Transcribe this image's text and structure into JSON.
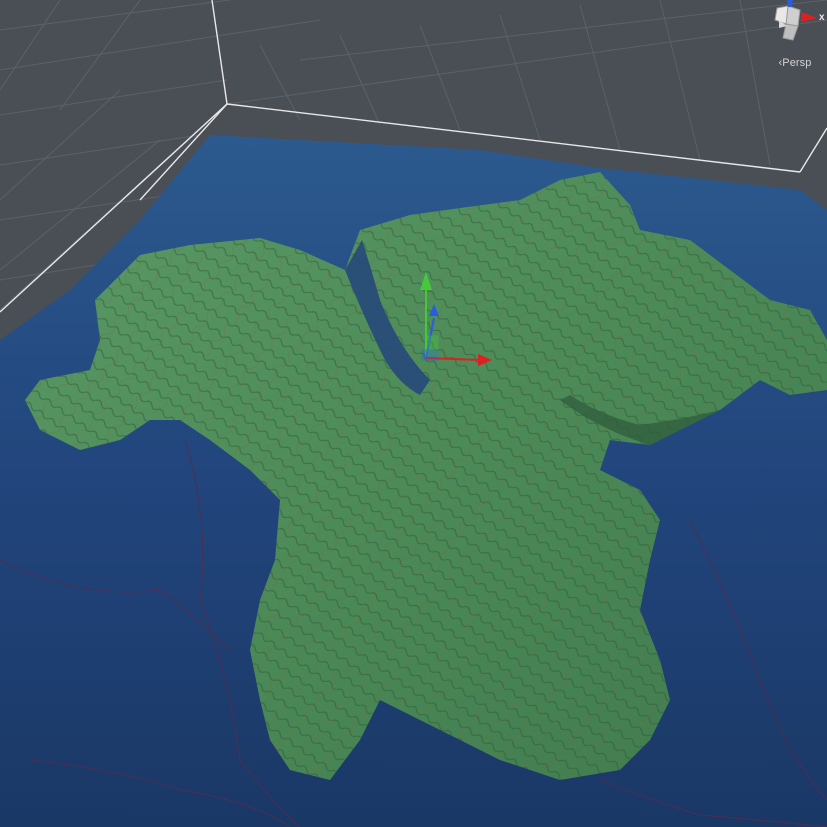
{
  "viewport": {
    "projection_label": "Persp",
    "x_axis_label": "x"
  },
  "colors": {
    "background": "#4a4e55",
    "grid_line": "#5c616a",
    "bounds_line": "#e8e8e8",
    "water": "#20427a",
    "land": "#4f8f5c",
    "gizmo_x": "#e02020",
    "gizmo_y": "#46c83a",
    "gizmo_z": "#2a5ce0"
  },
  "icons": {
    "scene_orientation": "axis-cube-icon",
    "move_tool": "move-gizmo-icon"
  }
}
